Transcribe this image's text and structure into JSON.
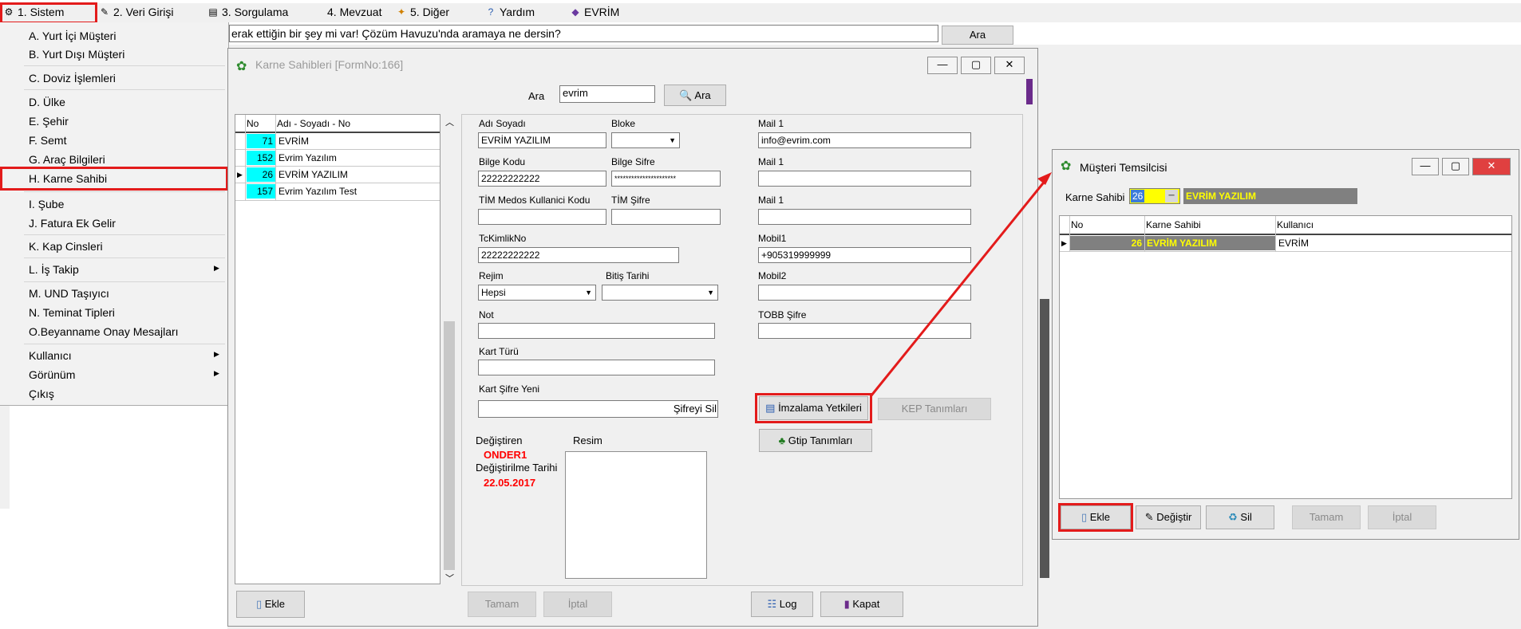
{
  "menubar": {
    "items": [
      {
        "label": "1. Sistem",
        "icon": "system-icon"
      },
      {
        "label": "2. Veri Girişi",
        "icon": "data-entry-icon"
      },
      {
        "label": "3. Sorgulama",
        "icon": "query-icon"
      },
      {
        "label": "4. Mevzuat",
        "icon": ""
      },
      {
        "label": "5. Diğer",
        "icon": "other-icon"
      },
      {
        "label": "Yardım",
        "icon": "help-icon"
      },
      {
        "label": "EVRİM",
        "icon": "evrim-icon"
      }
    ]
  },
  "dropdown": {
    "items": [
      "A. Yurt İçi Müşteri",
      "B. Yurt Dışı Müşteri",
      "C. Doviz İşlemleri",
      "D. Ülke",
      "E. Şehir",
      "F. Semt",
      "G. Araç Bilgileri",
      "H. Karne Sahibi",
      "I. Şube",
      "J. Fatura Ek Gelir",
      "K. Kap Cinsleri",
      "L. İş Takip",
      "M. UND Taşıyıcı",
      "N. Teminat Tipleri",
      "O.Beyanname Onay Mesajları",
      "Kullanıcı",
      "Görünüm",
      "Çıkış"
    ]
  },
  "search": {
    "text": "erak ettiğin bir şey mi var! Çözüm Havuzu'nda aramaya ne dersin?",
    "button": "Ara"
  },
  "karne_window": {
    "title": "Karne Sahibleri [FormNo:166]",
    "search_label": "Ara",
    "search_value": "evrim",
    "search_button": "Ara",
    "list_headers": [
      "No",
      "Adı - Soyadı - No"
    ],
    "list_rows": [
      {
        "no": "71",
        "name": "EVRİM"
      },
      {
        "no": "152",
        "name": "Evrim Yazılım"
      },
      {
        "no": "26",
        "name": "EVRİM YAZILIM"
      },
      {
        "no": "157",
        "name": "Evrim Yazılım Test"
      }
    ],
    "fields": {
      "adi_soyadi_label": "Adı Soyadı",
      "adi_soyadi": "EVRİM YAZILIM",
      "bloke_label": "Bloke",
      "bloke": "",
      "mail1_label": "Mail 1",
      "mail1": "info@evrim.com",
      "bilge_kodu_label": "Bilge Kodu",
      "bilge_kodu": "22222222222",
      "bilge_sifre_label": "Bilge Sifre",
      "bilge_sifre": "**********************",
      "mail1b_label": "Mail 1",
      "mail1b": "",
      "tim_medos_label": "TİM Medos Kullanici Kodu",
      "tim_medos": "",
      "tim_sifre_label": "TİM Şifre",
      "tim_sifre": "",
      "mail1c_label": "Mail 1",
      "mail1c": "",
      "tckimlik_label": "TcKimlikNo",
      "tckimlik": "22222222222",
      "mobil1_label": "Mobil1",
      "mobil1": "+905319999999",
      "rejim_label": "Rejim",
      "rejim": "Hepsi",
      "bitis_label": "Bitiş Tarihi",
      "bitis": "",
      "mobil2_label": "Mobil2",
      "mobil2": "",
      "not_label": "Not",
      "not": "",
      "tobb_label": "TOBB Şifre",
      "tobb": "",
      "kart_turu_label": "Kart Türü",
      "kart_turu": "",
      "kart_sifre_label": "Kart Şifre Yeni",
      "kart_sifre": "",
      "sifreyi_sil": "Şifreyi Sil",
      "degistiren_label": "Değiştiren",
      "degistiren": "ONDER1",
      "degistirilme_label": "Değiştirilme Tarihi",
      "degistirilme": "22.05.2017",
      "resim_label": "Resim"
    },
    "buttons": {
      "imzalama": "İmzalama Yetkileri",
      "kep": "KEP Tanımları",
      "gtip": "Gtip Tanımları",
      "ekle": "Ekle",
      "tamam": "Tamam",
      "iptal": "İptal",
      "log": "Log",
      "kapat": "Kapat"
    }
  },
  "musteri_window": {
    "title": "Müşteri Temsilcisi",
    "karne_label": "Karne Sahibi",
    "karne_no": "26",
    "karne_name": "EVRİM YAZILIM",
    "headers": [
      "No",
      "Karne Sahibi",
      "Kullanıcı"
    ],
    "rows": [
      {
        "no": "26",
        "karne": "EVRİM YAZILIM",
        "kullanici": "EVRİM"
      }
    ],
    "buttons": {
      "ekle": "Ekle",
      "degistir": "Değiştir",
      "sil": "Sil",
      "tamam": "Tamam",
      "iptal": "İptal"
    }
  },
  "colors": {
    "highlight_red": "#e31b1b",
    "no_cell_cyan": "#00ffff",
    "date_red": "#ff0000",
    "selected_row_gray": "#808080",
    "selected_row_text": "#ffff00"
  }
}
